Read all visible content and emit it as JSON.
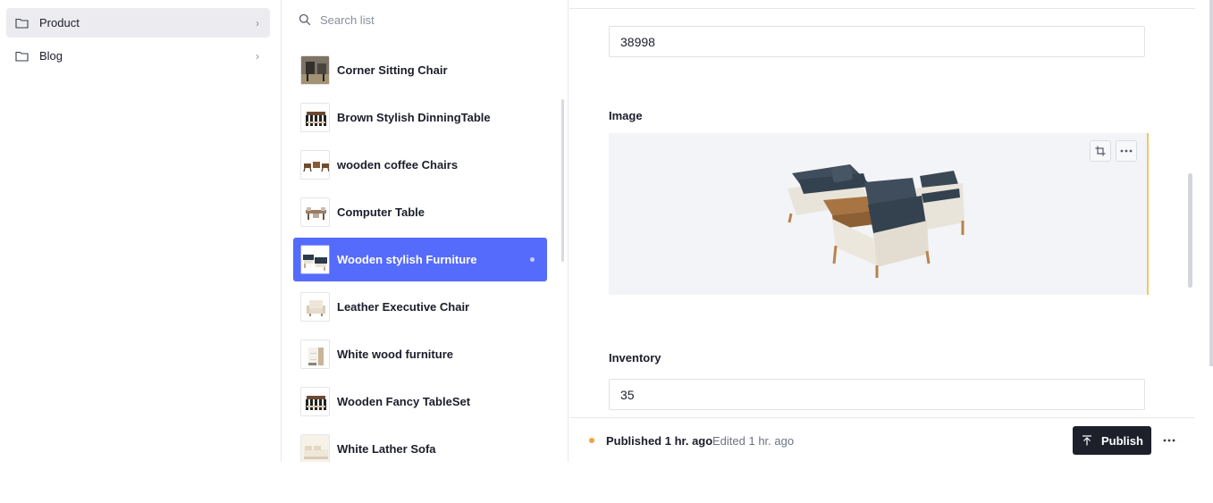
{
  "nav": {
    "items": [
      {
        "label": "Product",
        "icon": "folder-icon",
        "selected": true
      },
      {
        "label": "Blog",
        "icon": "folder-icon",
        "selected": false
      }
    ],
    "chevron": "›"
  },
  "list": {
    "search_placeholder": "Search list",
    "documents": [
      {
        "title": "Corner Sitting Chair"
      },
      {
        "title": "Brown Stylish DinningTable"
      },
      {
        "title": "wooden coffee Chairs"
      },
      {
        "title": "Computer Table"
      },
      {
        "title": "Wooden stylish Furniture",
        "active": true
      },
      {
        "title": "Leather Executive Chair"
      },
      {
        "title": "White wood furniture"
      },
      {
        "title": "Wooden Fancy TableSet"
      },
      {
        "title": "White Lather Sofa"
      }
    ]
  },
  "editor": {
    "price_value": "38998",
    "image_label": "Image",
    "inventory_label": "Inventory",
    "inventory_value": "35"
  },
  "footer": {
    "published": "Published 1 hr. ago",
    "edited": "Edited 1 hr. ago",
    "publish_label": "Publish"
  },
  "colors": {
    "accent": "#556bfc",
    "publish_button": "#1d1f2b",
    "status_dot": "#f2a33a"
  }
}
